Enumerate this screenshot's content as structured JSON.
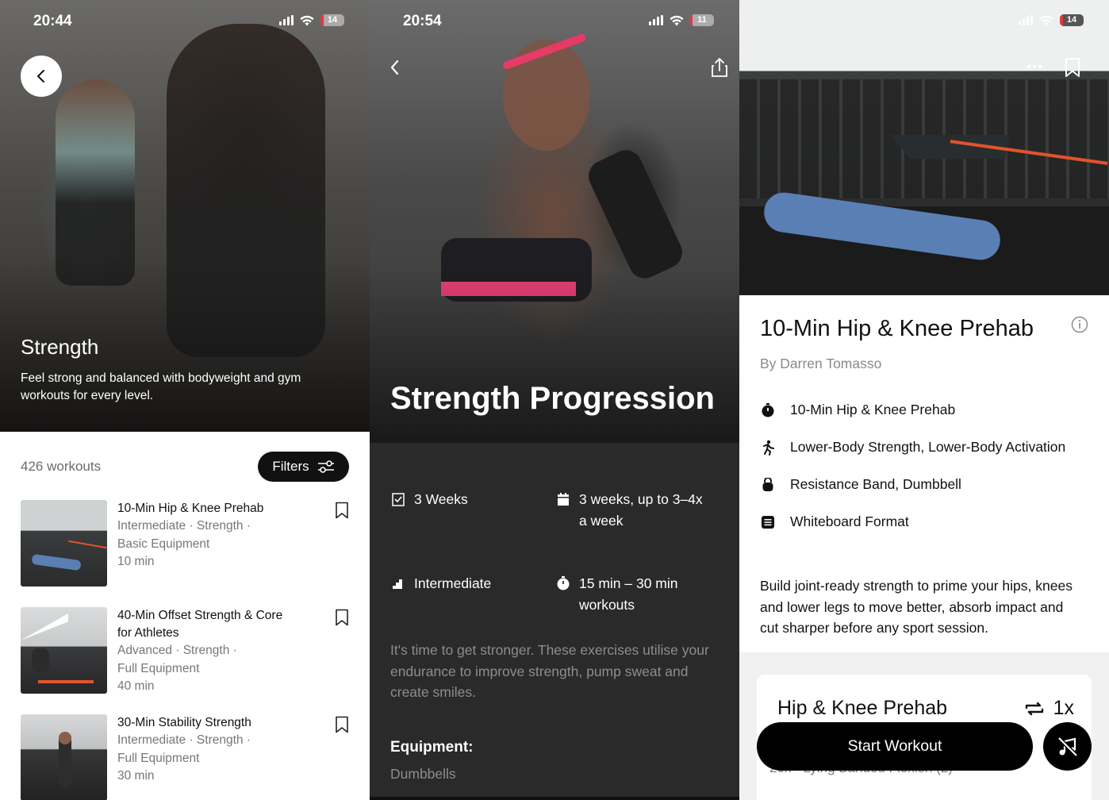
{
  "panel1": {
    "status": {
      "time": "20:44",
      "battery": "14"
    },
    "hero": {
      "title": "Strength",
      "description": "Feel strong and balanced with bodyweight and gym workouts for every level."
    },
    "count_label": "426 workouts",
    "filters_label": "Filters",
    "workouts": [
      {
        "title": "10-Min Hip & Knee Prehab",
        "meta": [
          "Intermediate · Strength ·",
          "Basic Equipment",
          "10 min"
        ]
      },
      {
        "title": "40-Min Offset Strength & Core for Athletes",
        "meta": [
          "Advanced · Strength ·",
          "Full Equipment",
          "40 min"
        ]
      },
      {
        "title": "30-Min Stability Strength",
        "meta": [
          "Intermediate · Strength ·",
          "Full Equipment",
          "30 min"
        ]
      }
    ]
  },
  "panel2": {
    "status": {
      "time": "20:54",
      "battery": "11"
    },
    "title": "Strength Progression",
    "duration": "3 Weeks",
    "frequency": "3 weeks, up to 3–4x a week",
    "level": "Intermediate",
    "session_length": "15 min – 30 min workouts",
    "description": "It's time to get stronger. These exercises utilise your endurance to improve strength, pump sweat and create smiles.",
    "equipment_label": "Equipment:",
    "equipment": "Dumbbells"
  },
  "panel3": {
    "status": {
      "battery": "14"
    },
    "title": "10-Min Hip & Knee Prehab",
    "author": "By Darren Tomasso",
    "attributes": [
      {
        "icon": "stopwatch-icon",
        "text": "10-Min Hip & Knee Prehab"
      },
      {
        "icon": "running-figure-icon",
        "text": "Lower-Body Strength, Lower-Body Activation"
      },
      {
        "icon": "kettlebell-icon",
        "text": "Resistance Band, Dumbbell"
      },
      {
        "icon": "list-icon",
        "text": "Whiteboard Format"
      }
    ],
    "description": "Build joint-ready strength to prime your hips, knees and lower legs to move better, absorb impact and cut sharper before any sport session.",
    "section_title": "Hip & Knee Prehab",
    "repeat_label": "1x",
    "next_exercise_peek": "20x · Lying Banded Flexion (L)",
    "start_button": "Start Workout"
  },
  "colors": {
    "accent": "#000000",
    "battery_low": "#e0393e",
    "dark_panel": "#2a2a2a"
  }
}
